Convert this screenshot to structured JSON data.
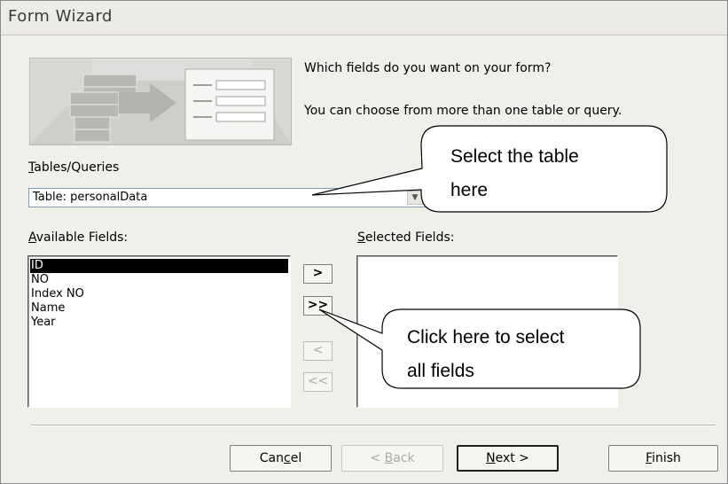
{
  "window": {
    "title": "Form Wizard"
  },
  "prompt": {
    "line1": "Which fields do you want on your form?",
    "line2": "You can choose from more than one table or query."
  },
  "tables_queries": {
    "label_accel": "T",
    "label_rest": "ables/Queries",
    "selected": "Table: personalData",
    "dropdown_glyph": "▼"
  },
  "available_fields": {
    "label_accel": "A",
    "label_rest": "vailable Fields:",
    "items": [
      "ID",
      "NO",
      "Index NO",
      "Name",
      "Year"
    ],
    "selected_index": 0
  },
  "selected_fields": {
    "label_accel": "S",
    "label_rest": "elected Fields:",
    "items": []
  },
  "move_buttons": {
    "add_one": ">",
    "add_all": ">>",
    "remove_one": "<",
    "remove_all": "<<"
  },
  "buttons": {
    "cancel_pre": "Can",
    "cancel_accel": "c",
    "cancel_post": "el",
    "back_pre": "< ",
    "back_accel": "B",
    "back_post": "ack",
    "next_accel": "N",
    "next_post": "ext >",
    "finish_accel": "F",
    "finish_post": "inish"
  },
  "callouts": {
    "table": {
      "line1": "Select the table",
      "line2": "here"
    },
    "fields": {
      "line1": "Click here to select",
      "line2": "all fields"
    }
  }
}
